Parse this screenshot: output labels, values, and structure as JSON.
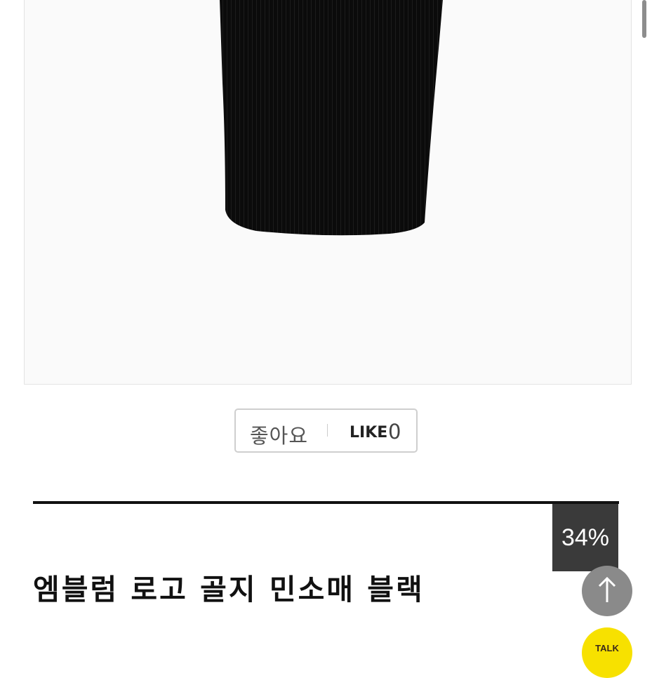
{
  "like": {
    "label_ko": "좋아요",
    "label_en": "LIKE",
    "count": "0"
  },
  "product": {
    "discount": "34%",
    "title": "엠블럼 로고 골지 민소매 블랙"
  },
  "floating": {
    "scroll_top_icon": "arrow-up-icon",
    "talk_icon": "kakaotalk-icon",
    "talk_label": "TALK"
  },
  "colors": {
    "badge_bg": "#3a3a3a",
    "scroll_top_bg": "#8a8a8a",
    "talk_bg": "#f7e100"
  }
}
